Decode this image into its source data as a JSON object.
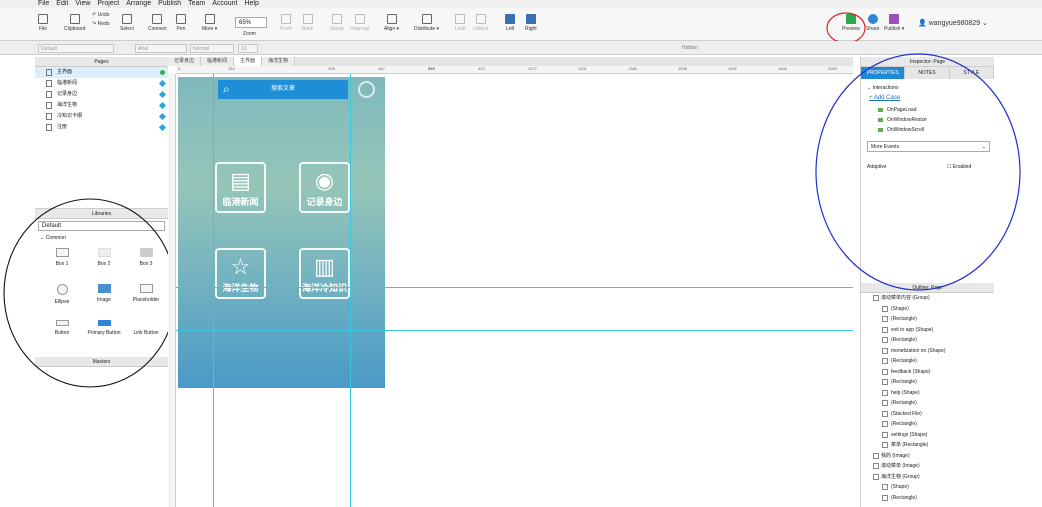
{
  "menu": [
    "File",
    "Edit",
    "View",
    "Project",
    "Arrange",
    "Publish",
    "Team",
    "Account",
    "Help"
  ],
  "toolbar": {
    "file": "File",
    "clipboard": "Clipboard",
    "undo": "Undo",
    "redo": "Redo",
    "select": "Select",
    "connect": "Connect",
    "pen": "Pen",
    "more": "More ▾",
    "zoom_value": "65%",
    "zoom": "Zoom",
    "front": "Front",
    "back": "Back",
    "group": "Group",
    "ungroup": "Ungroup",
    "align": "Align ▾",
    "distribute": "Distribute ▾",
    "lock": "Lock",
    "unlock": "Unlock",
    "left": "Left",
    "right": "Right",
    "preview": "Preview",
    "share": "Share",
    "publish": "Publish ▾",
    "user": "wangyue980829"
  },
  "format": {
    "style": "Default",
    "font": "Arial",
    "weight": "Normal",
    "size": "13",
    "hidden": "Hidden"
  },
  "pages": {
    "title": "Pages",
    "items": [
      {
        "label": "主界面",
        "status": "ok"
      },
      {
        "label": "临港新闻",
        "status": "diamond"
      },
      {
        "label": "记录身边",
        "status": "diamond"
      },
      {
        "label": "海洋生物",
        "status": "diamond"
      },
      {
        "label": "冷知识卡纲",
        "status": "diamond"
      },
      {
        "label": "注册",
        "status": "diamond"
      }
    ]
  },
  "libraries": {
    "title": "Libraries",
    "selected": "Default",
    "group": "Common",
    "items": [
      "Box 1",
      "Box 2",
      "Box 3",
      "Ellipse",
      "Image",
      "Placeholder",
      "Button",
      "Primary Button",
      "Link Button"
    ]
  },
  "masters": {
    "title": "Masters"
  },
  "canvas": {
    "tabs": [
      "记录身边",
      "临港新闻",
      "主界面",
      "海洋生物"
    ],
    "active_tab": 2,
    "ruler_h": [
      "0",
      "154",
      "308",
      "462",
      "615",
      "769",
      "923",
      "1077",
      "1231",
      "1385",
      "1538",
      "1692",
      "1846",
      "2000"
    ],
    "search_text": "搜索文章",
    "tiles": [
      {
        "label": "临港新闻",
        "icon": "news-icon",
        "glyph": "▤"
      },
      {
        "label": "记录身边",
        "icon": "camera-icon",
        "glyph": "◉"
      },
      {
        "label": "海洋生物",
        "icon": "star-icon",
        "glyph": "☆"
      },
      {
        "label": "海洋冷知识",
        "icon": "book-icon",
        "glyph": "▥"
      }
    ]
  },
  "inspector": {
    "title": "Inspector: Page",
    "tabs": [
      "PROPERTIES",
      "NOTES",
      "STYLE"
    ],
    "interactions": "Interactions",
    "add_case": "Add Case",
    "events": [
      "OnPageLoad",
      "OnWindowResize",
      "OnWindowScroll"
    ],
    "more_events": "More Events",
    "adaptive": "Adaptive",
    "enabled": "Enabled"
  },
  "outline": {
    "title": "Outline: Page",
    "items": [
      {
        "label": "滚动菜单内容 (Group)",
        "indent": 0
      },
      {
        "label": "(Shape)",
        "indent": 1
      },
      {
        "label": "(Rectangle)",
        "indent": 1
      },
      {
        "label": "exit to app (Shape)",
        "indent": 1
      },
      {
        "label": "(Rectangle)",
        "indent": 1
      },
      {
        "label": "monetization on (Shape)",
        "indent": 1
      },
      {
        "label": "(Rectangle)",
        "indent": 1
      },
      {
        "label": "feedback (Shape)",
        "indent": 1
      },
      {
        "label": "(Rectangle)",
        "indent": 1
      },
      {
        "label": "help (Shape)",
        "indent": 1
      },
      {
        "label": "(Rectangle)",
        "indent": 1
      },
      {
        "label": "(Stacked File)",
        "indent": 1
      },
      {
        "label": "(Rectangle)",
        "indent": 1
      },
      {
        "label": "settings (Shape)",
        "indent": 1
      },
      {
        "label": "菜单 (Rectangle)",
        "indent": 1
      },
      {
        "label": "我的 (Image)",
        "indent": 0
      },
      {
        "label": "滚动菜单 (Image)",
        "indent": 0
      },
      {
        "label": "海洋生物 (Group)",
        "indent": 0
      },
      {
        "label": "(Shape)",
        "indent": 1
      },
      {
        "label": "(Rectangle)",
        "indent": 1
      }
    ]
  }
}
